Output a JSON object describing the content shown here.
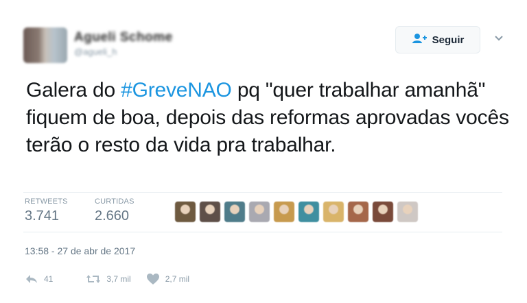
{
  "user": {
    "name": "Agueli Schome",
    "handle": "@agueli_h"
  },
  "follow": {
    "label": "Seguir",
    "icon": "add-user-icon"
  },
  "menu": {
    "icon": "chevron-down-icon"
  },
  "tweet": {
    "text_before": "Galera do ",
    "hashtag": "#GreveNAO",
    "text_after": " pq \"quer trabalhar amanhã\" fiquem de boa, depois das reformas aprovadas vocês terão o resto da vida pra trabalhar."
  },
  "stats": {
    "retweets_label": "RETWEETS",
    "retweets_value": "3.741",
    "likes_label": "CURTIDAS",
    "likes_value": "2.660"
  },
  "likers": [
    {
      "color": "#6e5a40"
    },
    {
      "color": "#5e4f48"
    },
    {
      "color": "#4f7c8a"
    },
    {
      "color": "#a9a9b1"
    },
    {
      "color": "#c79a4e"
    },
    {
      "color": "#3f8fa0"
    },
    {
      "color": "#d9b46a"
    },
    {
      "color": "#a5674a"
    },
    {
      "color": "#7a4a3a"
    },
    {
      "color": "#cfc8c4"
    }
  ],
  "timestamp": "13:58 - 27 de abr de 2017",
  "actions": {
    "reply_count": "41",
    "retweet_count": "3,7 mil",
    "like_count": "2,7 mil",
    "reply_icon": "reply-icon",
    "retweet_icon": "retweet-icon",
    "like_icon": "heart-icon"
  },
  "colors": {
    "hashtag": "#1b95e0",
    "text": "#14171a",
    "muted": "#8899a6"
  }
}
